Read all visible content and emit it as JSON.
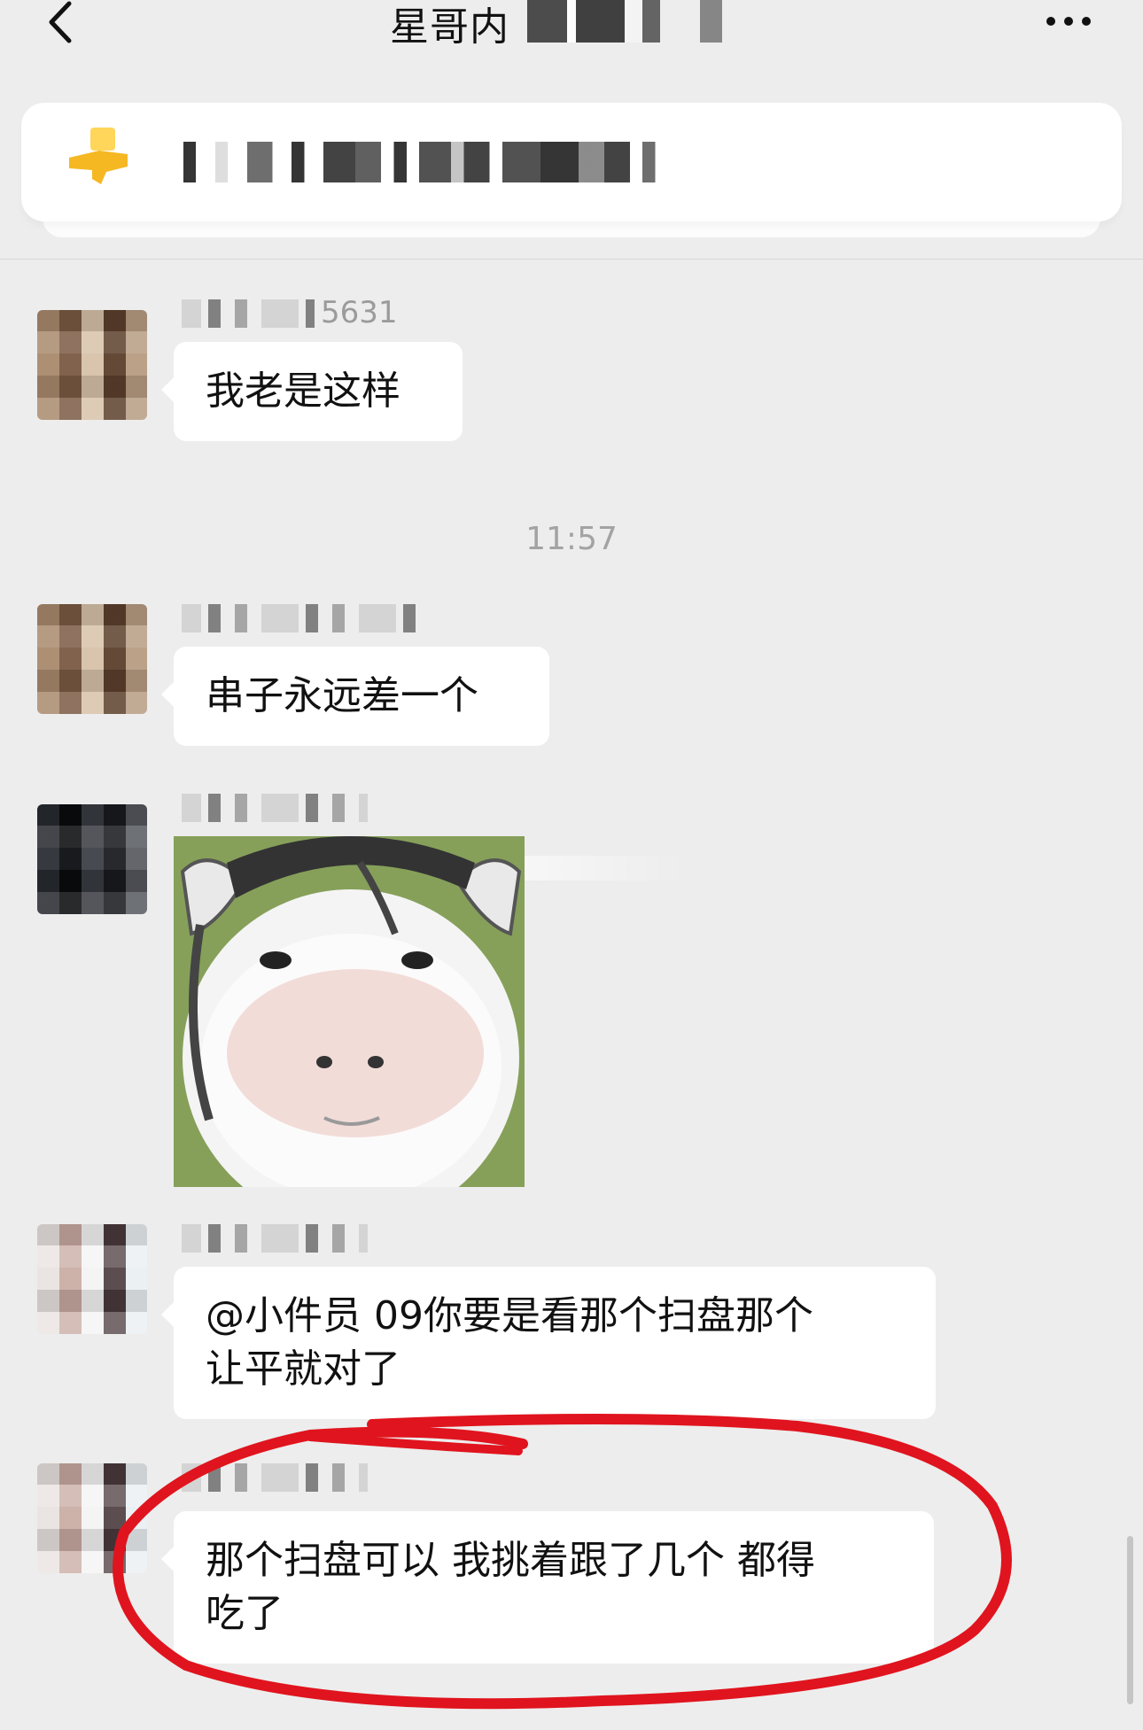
{
  "header": {
    "title": "星哥内",
    "back_icon": "chevron-left-icon",
    "more_icon": "more-dots-icon"
  },
  "pinned": {
    "icon": "pin-icon",
    "accent": "#f7c32e"
  },
  "messages": [
    {
      "sender_suffix": "5631",
      "text": "我老是这样"
    },
    {
      "time": "11:57"
    },
    {
      "text": "串子永远差一个"
    },
    {
      "type": "sticker"
    },
    {
      "text_line1": "@小件员 09你要是看那个扫盘那个",
      "text_line2": "让平就对了"
    },
    {
      "text_line1": "那个扫盘可以 我挑着跟了几个 都得",
      "text_line2": "吃了"
    }
  ],
  "colors": {
    "background": "#ededed",
    "bubble": "#ffffff",
    "annotation": "#e0141e"
  }
}
